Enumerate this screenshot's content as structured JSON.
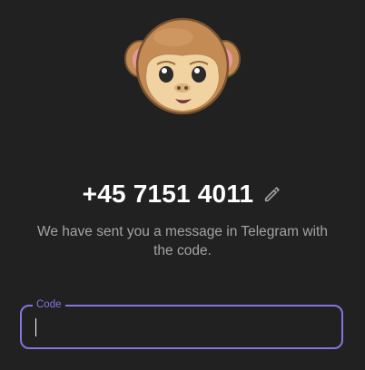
{
  "login": {
    "phone_number": "+45 7151 4011",
    "message": "We have sent you a message in Telegram with the code.",
    "code_label": "Code",
    "code_value": ""
  },
  "icons": {
    "avatar": "monkey-face-icon",
    "edit": "pencil-icon"
  },
  "colors": {
    "background": "#212121",
    "accent": "#8774e1",
    "text_primary": "#ffffff",
    "text_secondary": "#a3a3a3"
  }
}
